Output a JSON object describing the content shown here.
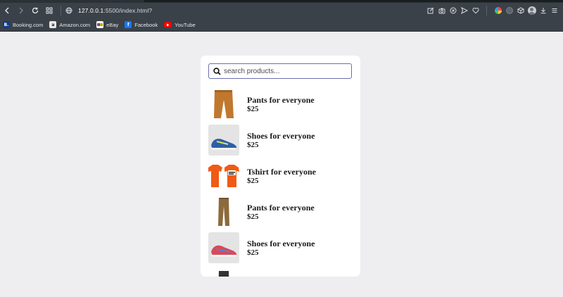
{
  "browser": {
    "url_host": "127.0.0.1",
    "url_rest": ":5500/index.html?",
    "bookmarks": [
      {
        "label": "Booking.com",
        "icon": "booking-icon"
      },
      {
        "label": "Amazon.com",
        "icon": "amazon-icon"
      },
      {
        "label": "eBay",
        "icon": "ebay-icon"
      },
      {
        "label": "Facebook",
        "icon": "facebook-icon"
      },
      {
        "label": "YouTube",
        "icon": "youtube-icon"
      }
    ]
  },
  "search": {
    "placeholder": "search products..."
  },
  "products": [
    {
      "name": "Pants for everyone",
      "price": "$25",
      "image": "brown-pants",
      "color": "#c0782f"
    },
    {
      "name": "Shoes for everyone",
      "price": "$25",
      "image": "blue-sneaker",
      "color": "#2d5fa8"
    },
    {
      "name": "Tshirt for everyone",
      "price": "$25",
      "image": "orange-tshirts",
      "color": "#f05a14"
    },
    {
      "name": "Pants for everyone",
      "price": "$25",
      "image": "khaki-pants",
      "color": "#8c6a3c"
    },
    {
      "name": "Shoes for everyone",
      "price": "$25",
      "image": "red-sneaker",
      "color": "#d64a5a"
    },
    {
      "name": "",
      "price": "",
      "image": "dark-item",
      "color": "#333333"
    }
  ]
}
